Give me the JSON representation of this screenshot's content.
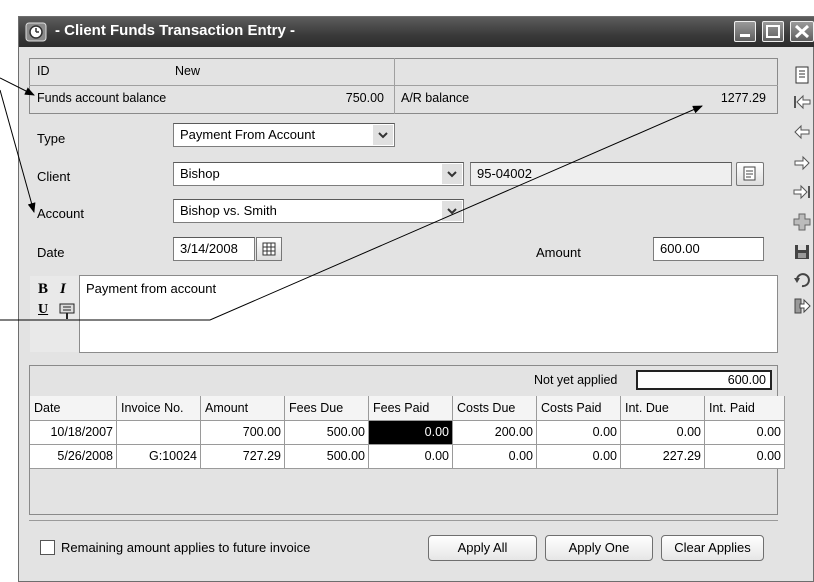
{
  "window": {
    "title": "- Client Funds Transaction Entry -"
  },
  "info": {
    "id_label": "ID",
    "id_value": "New",
    "funds_label": "Funds account balance",
    "funds_value": "750.00",
    "ar_label": "A/R balance",
    "ar_value": "1277.29"
  },
  "form": {
    "type_label": "Type",
    "type_value": "Payment From Account",
    "client_label": "Client",
    "client_value": "Bishop",
    "client_code": "95-04002",
    "account_label": "Account",
    "account_value": "Bishop vs. Smith",
    "date_label": "Date",
    "date_value": "3/14/2008",
    "amount_label": "Amount",
    "amount_value": "600.00"
  },
  "memo": {
    "text": "Payment from account",
    "bold_label": "B",
    "italic_label": "I",
    "underline_label": "U"
  },
  "grid": {
    "not_applied_label": "Not yet applied",
    "not_applied_value": "600.00",
    "columns": [
      "Date",
      "Invoice No.",
      "Amount",
      "Fees Due",
      "Fees Paid",
      "Costs Due",
      "Costs Paid",
      "Int. Due",
      "Int. Paid"
    ],
    "rows": [
      [
        "10/18/2007",
        "",
        "700.00",
        "500.00",
        "0.00",
        "200.00",
        "0.00",
        "0.00",
        "0.00"
      ],
      [
        "5/26/2008",
        "G:10024",
        "727.29",
        "500.00",
        "0.00",
        "0.00",
        "0.00",
        "227.29",
        "0.00"
      ]
    ]
  },
  "footer": {
    "checkbox_label": "Remaining amount applies to future invoice",
    "apply_all": "Apply All",
    "apply_one": "Apply One",
    "clear_applies": "Clear Applies"
  },
  "icons": {
    "app": "clock-icon",
    "toolbar": [
      "notes-icon",
      "first-record-icon",
      "previous-record-icon",
      "next-record-icon",
      "last-record-icon",
      "add-record-icon",
      "save-icon",
      "undo-icon",
      "exit-icon"
    ]
  },
  "colors": {
    "titlebar": "#3a3a3a",
    "window_bg": "#e3e3e3",
    "selected_cell": "#000000"
  }
}
